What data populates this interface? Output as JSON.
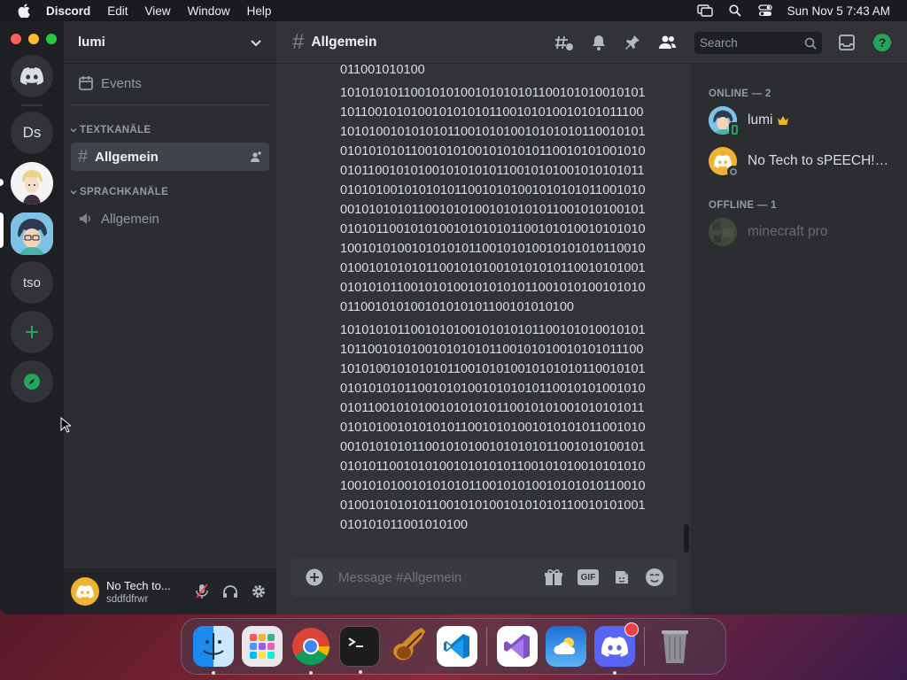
{
  "menubar": {
    "app": "Discord",
    "items": [
      "Edit",
      "View",
      "Window",
      "Help"
    ],
    "clock": "Sun Nov 5  7:43 AM"
  },
  "servers": [
    {
      "label": ""
    },
    {
      "label": "Ds"
    },
    {
      "label": ""
    },
    {
      "label": ""
    },
    {
      "label": "tso"
    }
  ],
  "guild": {
    "name": "lumi"
  },
  "channels": {
    "events": "Events",
    "text_category": "TEXTKANÄLE",
    "text_channel": "Allgemein",
    "voice_category": "SPRACHKANÄLE",
    "voice_channel": "Allgemein"
  },
  "user": {
    "name": "No Tech to...",
    "status": "sddfdfrwr"
  },
  "header": {
    "channel": "Allgemein",
    "search_placeholder": "Search"
  },
  "messages": [
    "011001010100",
    "1010101011001010100101010101100101010010101\n1011001010100101010101100101010010101011100\n1010100101010101100101010010101010110010101\n0101010101100101010010101010110010101001010\n0101100101010010101010110010101001010101011\n0101010010101010110010101001010101011001010\n0010101010110010101001010101011001010100101\n0101011001010100101010101100101010010101010\n1001010100101010101100101010010101010110010\n0100101010101100101010010101010110010101001\n0101010110010101001010101011001010100101010\n011001010100101010101100101010100",
    "1010101011001010100101010101100101010010101\n1011001010100101010101100101010010101011100\n1010100101010101100101010010101010110010101\n0101010101100101010010101010110010101001010\n0101100101010010101010110010101001010101011\n0101010010101010110010101001010101011001010\n0010101010110010101001010101011001010100101\n0101011001010100101010101100101010010101010\n1001010100101010101100101010010101010110010\n0100101010101100101010010101010110010101001\n010101011001010100"
  ],
  "composer": {
    "placeholder": "Message #Allgemein",
    "gif": "GIF"
  },
  "members": {
    "online_header": "ONLINE — 2",
    "offline_header": "OFFLINE — 1",
    "online": [
      {
        "name": "lumi"
      },
      {
        "name": "No Tech to sPEECH!!!!..."
      }
    ],
    "offline": [
      {
        "name": "minecraft pro"
      }
    ]
  },
  "colors": {
    "blurple": "#5865f2",
    "green": "#23a55a",
    "crown": "#f0b232"
  },
  "dock": [
    "finder",
    "launchpad",
    "chrome",
    "terminal",
    "garageband",
    "vscode",
    "visual-studio",
    "weather",
    "discord",
    "trash"
  ]
}
